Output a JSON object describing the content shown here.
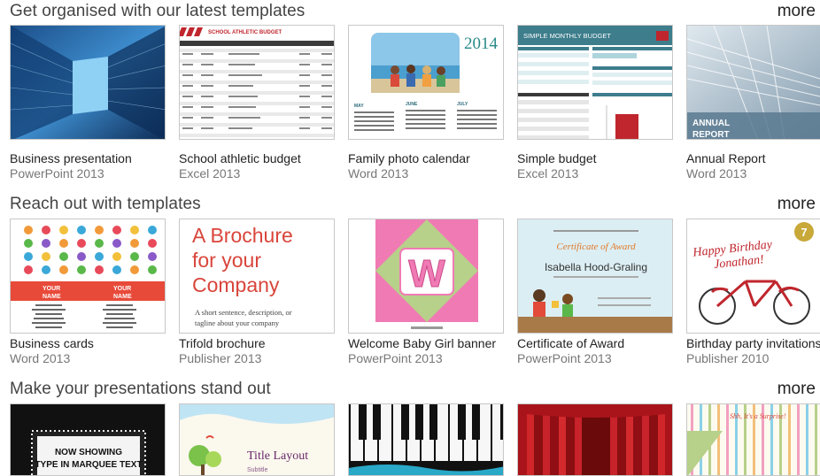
{
  "sections": [
    {
      "title": "Get organised with our latest templates",
      "more": "more",
      "cards": [
        {
          "name": "Business presentation",
          "app": "PowerPoint 2013"
        },
        {
          "name": "School athletic budget",
          "app": "Excel 2013",
          "thumb_title": "SCHOOL ATHLETIC BUDGET"
        },
        {
          "name": "Family photo calendar",
          "app": "Word 2013",
          "thumb_year": "2014",
          "thumb_months": [
            "MAY",
            "JUNE",
            "JULY"
          ]
        },
        {
          "name": "Simple budget",
          "app": "Excel 2013",
          "thumb_title": "SIMPLE MONTHLY BUDGET"
        },
        {
          "name": "Annual Report",
          "app": "Word 2013",
          "thumb_title_1": "ANNUAL",
          "thumb_title_2": "REPORT"
        }
      ]
    },
    {
      "title": "Reach out with templates",
      "more": "more",
      "cards": [
        {
          "name": "Business cards",
          "app": "Word 2013",
          "thumb_name_1": "YOUR",
          "thumb_name_2": "NAME"
        },
        {
          "name": "Trifold brochure",
          "app": "Publisher 2013",
          "thumb_line_1": "A Brochure",
          "thumb_line_2": "for your",
          "thumb_line_3": "Company",
          "thumb_tag_1": "A short sentence, description, or",
          "thumb_tag_2": "tagline about your company"
        },
        {
          "name": "Welcome Baby Girl banner",
          "app": "PowerPoint 2013",
          "thumb_letter": "W"
        },
        {
          "name": "Certificate of Award",
          "app": "PowerPoint 2013",
          "thumb_title": "Certificate of Award",
          "thumb_person": "Isabella Hood-Graling"
        },
        {
          "name": "Birthday party invitations",
          "app": "Publisher 2010",
          "thumb_line_1": "Happy Birthday",
          "thumb_line_2": "Jonathan!",
          "thumb_badge": "7"
        }
      ]
    },
    {
      "title": "Make your presentations stand out",
      "more": "more",
      "cards": [
        {
          "thumb_line_1": "NOW SHOWING",
          "thumb_line_2": "TYPE IN MARQUEE TEXT"
        },
        {
          "thumb_title": "Title Layout",
          "thumb_sub": "Subtitle"
        },
        {},
        {
          "thumb_text": "Shh, It's a Surprise!"
        },
        {}
      ]
    }
  ],
  "colors": {
    "excel_red": "#c0262d",
    "teal": "#3d7d8c",
    "brochure_red": "#d9453b",
    "banner_pink": "#f07ab4",
    "banner_green": "#b7d08a"
  }
}
